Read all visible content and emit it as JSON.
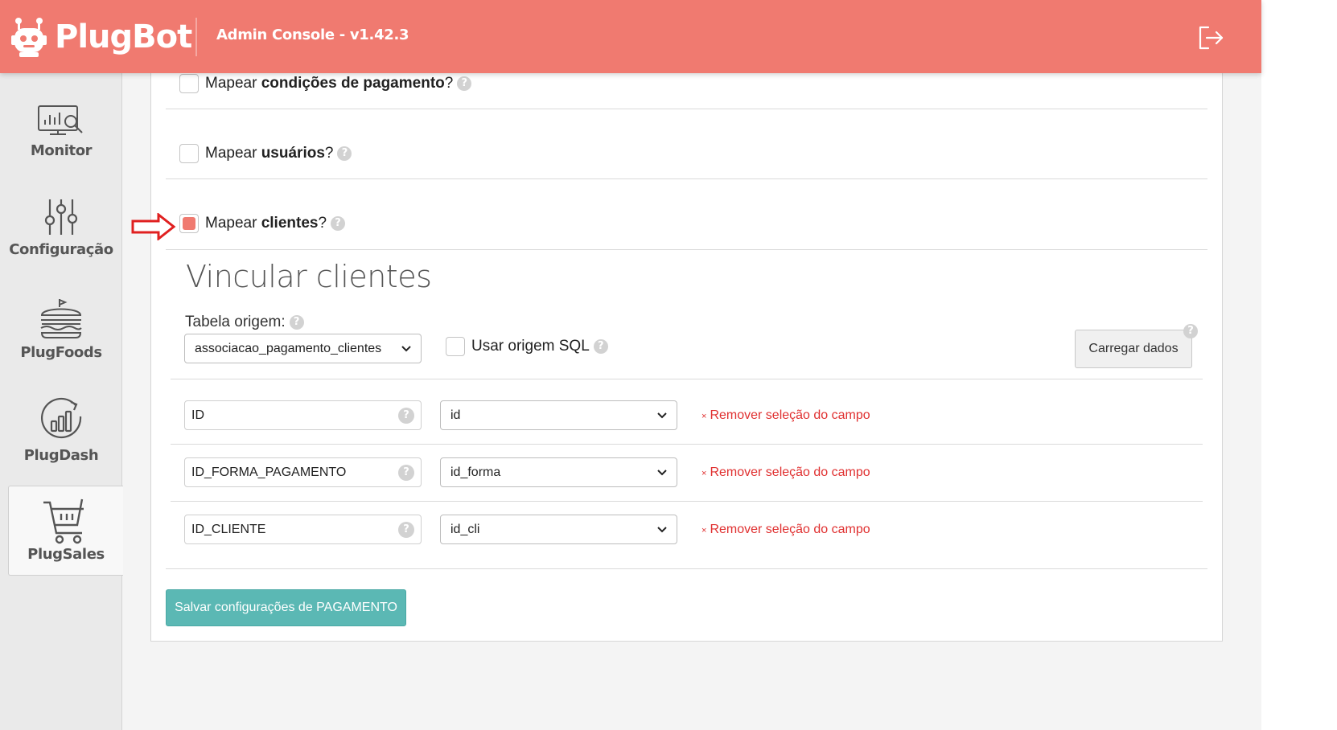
{
  "header": {
    "brand": "PlugBot",
    "title": "Admin Console - v1.42.3",
    "color": "#f07a70"
  },
  "sidebar": {
    "items": [
      {
        "label": "Monitor",
        "icon": "monitor-icon"
      },
      {
        "label": "Configuração",
        "icon": "sliders-icon"
      },
      {
        "label": "PlugFoods",
        "icon": "burger-icon"
      },
      {
        "label": "PlugDash",
        "icon": "chart-circle-icon"
      },
      {
        "label": "PlugSales",
        "icon": "cart-icon",
        "active": true
      }
    ]
  },
  "mapping": {
    "pagamento": {
      "prefix": "Mapear ",
      "bold": "condições de pagamento",
      "suffix": "?",
      "checked": false
    },
    "usuarios": {
      "prefix": "Mapear ",
      "bold": "usuários",
      "suffix": "?",
      "checked": false
    },
    "clientes": {
      "prefix": "Mapear ",
      "bold": "clientes",
      "suffix": "?",
      "checked": true
    }
  },
  "section": {
    "title": "Vincular clientes",
    "origin_label": "Tabela origem:",
    "origin_value": "associacao_pagamento_clientes",
    "sql_label": "Usar origem SQL",
    "load_button": "Carregar dados"
  },
  "fields": [
    {
      "name": "ID",
      "column": "id",
      "remove": "Remover seleção do campo"
    },
    {
      "name": "ID_FORMA_PAGAMENTO",
      "column": "id_forma",
      "remove": "Remover seleção do campo"
    },
    {
      "name": "ID_CLIENTE",
      "column": "id_cli",
      "remove": "Remover seleção do campo"
    }
  ],
  "help_glyph": "?",
  "remove_glyph": "×",
  "save_button": "Salvar configurações de PAGAMENTO",
  "accent_teal": "#5bb8b4",
  "arrow_color": "#e02020"
}
